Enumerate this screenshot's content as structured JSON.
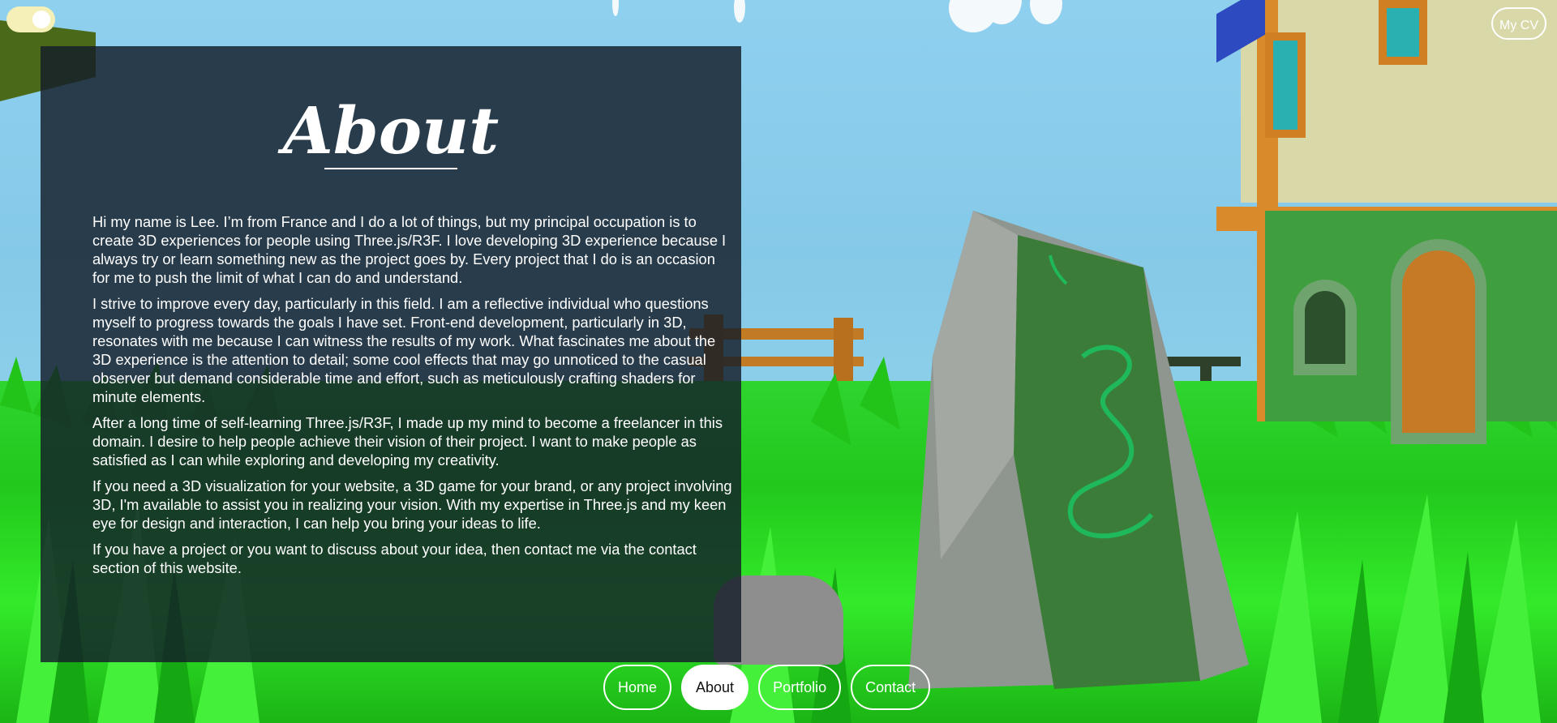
{
  "theme_toggle": {
    "icon": "sun-toggle-icon"
  },
  "cv_button": {
    "label": "My CV"
  },
  "about": {
    "title": "About",
    "paragraphs": [
      "Hi my name is Lee. I’m from France and I do a lot of things, but my principal occupation is to create 3D experiences for people using Three.js/R3F. I love developing 3D experience because I always try or learn something new as the project goes by. Every project that I do is an occasion for me to push the limit of what I can do and understand.",
      "I strive to improve every day, particularly in this field. I am a reflective individual who questions myself to progress towards the goals I have set. Front-end development, particularly in 3D, resonates with me because I can witness the results of my work. What fascinates me about the 3D experience is the attention to detail; some cool effects that may go unnoticed to the casual observer but demand considerable time and effort, such as meticulously crafting shaders for minute elements.",
      "After a long time of self-learning Three.js/R3F, I made up my mind to become a freelancer in this domain. I desire to help people achieve their vision of their project. I want to make people as satisfied as I can while exploring and developing my creativity.",
      "If you need a 3D visualization for your website, a 3D game for your brand, or any project involving 3D, I'm available to assist you in realizing your vision. With my expertise in Three.js and my keen eye for design and interaction, I can help you bring your ideas to life.",
      "If you have a project or you want to discuss about your idea, then contact me via the contact section of this website."
    ]
  },
  "nav": {
    "items": [
      {
        "label": "Home",
        "active": false
      },
      {
        "label": "About",
        "active": true
      },
      {
        "label": "Portfolio",
        "active": false
      },
      {
        "label": "Contact",
        "active": false
      }
    ]
  },
  "colors": {
    "sky": "#87cdea",
    "grass": "#2fd42f",
    "panel": "#141c28",
    "toggle": "#f5f0b8",
    "house_wall": "#d8d8a8",
    "house_trim": "#d98a2a",
    "stone": "#9a9a9a",
    "rune": "#1fb85a"
  }
}
